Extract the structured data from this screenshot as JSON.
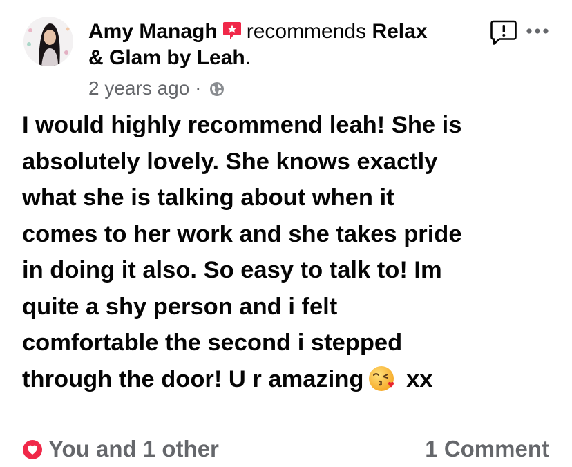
{
  "post": {
    "author": "Amy Managh",
    "action": "recommends",
    "page_name_part1": "Relax",
    "page_name_part2": "& Glam by Leah",
    "page_name_period": ".",
    "timestamp": "2 years ago",
    "separator": "·",
    "audience_icon": "globe-icon",
    "body_lines": [
      "I would highly recommend leah! She is",
      "absolutely lovely. She knows exactly",
      "what she is talking about when it",
      "comes to her work and she takes pride",
      "in doing it also. So easy to talk to! Im",
      "quite a shy person and i felt",
      "comfortable the second i stepped",
      "through the door! U r amazing"
    ],
    "body_end_emoji": "kissing-face-with-heart-emoji",
    "body_end_text": "xx"
  },
  "footer": {
    "reactions_text": "You and 1 other",
    "comments_text": "1 Comment"
  },
  "colors": {
    "text_primary": "#050505",
    "text_secondary": "#65676b",
    "recommend_badge": "#f02849",
    "heart_reaction": "#f02849"
  }
}
